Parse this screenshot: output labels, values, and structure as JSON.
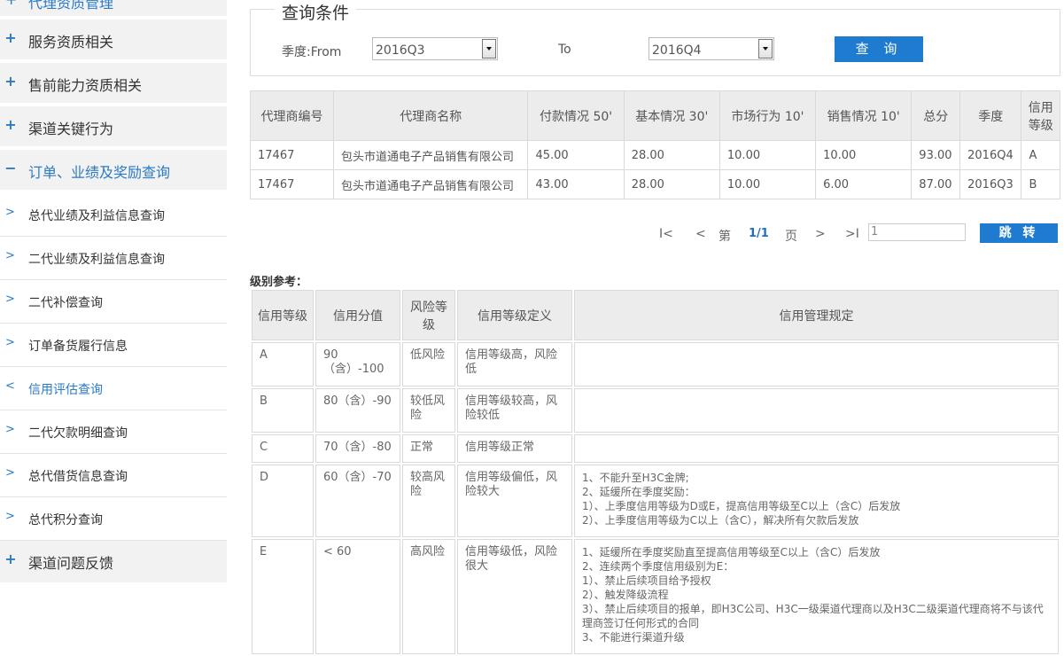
{
  "sidebar": {
    "cut_label": "代理资质管理",
    "cut_icon": "+",
    "main_items": [
      {
        "icon": "+",
        "label": "服务资质相关"
      },
      {
        "icon": "+",
        "label": "售前能力资质相关"
      },
      {
        "icon": "+",
        "label": "渠道关键行为"
      },
      {
        "icon": "−",
        "label": "订单、业绩及奖励查询"
      }
    ],
    "sub_items": [
      {
        "icon": ">",
        "label": "总代业绩及利益信息查询"
      },
      {
        "icon": ">",
        "label": "二代业绩及利益信息查询"
      },
      {
        "icon": ">",
        "label": "二代补偿查询"
      },
      {
        "icon": ">",
        "label": "订单备货履行信息"
      },
      {
        "icon": "<",
        "label": "信用评估查询"
      },
      {
        "icon": ">",
        "label": "二代欠款明细查询"
      },
      {
        "icon": ">",
        "label": "总代借货信息查询"
      },
      {
        "icon": ">",
        "label": "总代积分查询"
      }
    ],
    "bottom_item": {
      "icon": "+",
      "label": "渠道问题反馈"
    }
  },
  "query": {
    "title": "查询条件",
    "from_label": "季度:From",
    "from_value": "2016Q3",
    "to_label": "To",
    "to_value": "2016Q4",
    "search_label": "查 询"
  },
  "results": {
    "headers": [
      "代理商编号",
      "代理商名称",
      "付款情况 50'",
      "基本情况 30'",
      "市场行为 10'",
      "销售情况 10'",
      "总分",
      "季度",
      "信用等级"
    ],
    "rows": [
      [
        "17467",
        "包头市道通电子产品销售有限公司",
        "45.00",
        "28.00",
        "10.00",
        "10.00",
        "93.00",
        "2016Q4",
        "A"
      ],
      [
        "17467",
        "包头市道通电子产品销售有限公司",
        "43.00",
        "28.00",
        "10.00",
        "6.00",
        "87.00",
        "2016Q3",
        "B"
      ]
    ]
  },
  "pager": {
    "first": "I<",
    "prev": "<",
    "page_prefix": "第",
    "page_value": "1/1",
    "page_suffix": "页",
    "next": ">",
    "last": ">I",
    "input_value": "1",
    "jump_label": "跳 转"
  },
  "reference": {
    "label": "级别参考：",
    "headers": [
      "信用等级",
      "信用分值",
      "风险等级",
      "信用等级定义",
      "信用管理规定"
    ],
    "rows": [
      {
        "grade": "A",
        "score": "90（含）-100",
        "risk": "低风险",
        "definition": "信用等级高，风险低",
        "rules": []
      },
      {
        "grade": "B",
        "score": "80（含）-90",
        "risk": "较低风险",
        "definition": "信用等级较高，风险较低",
        "rules": []
      },
      {
        "grade": "C",
        "score": "70（含）-80",
        "risk": "正常",
        "definition": "信用等级正常",
        "rules": []
      },
      {
        "grade": "D",
        "score": "60（含）-70",
        "risk": "较高风险",
        "definition": "信用等级偏低，风险较大",
        "rules": [
          "1、不能升至H3C金牌;",
          "2、延缓所在季度奖励：",
          "1）、上季度信用等级为D或E，提高信用等级至C以上（含C）后发放",
          "2）、上季度信用等级为C以上（含C），解决所有欠款后发放"
        ]
      },
      {
        "grade": "E",
        "score": "< 60",
        "risk": "高风险",
        "definition": "信用等级低，风险很大",
        "rules": [
          "1、延缓所在季度奖励直至提高信用等级至C以上（含C）后发放",
          "2、连续两个季度信用级别为E：",
          "1）、禁止后续项目给予授权",
          "2）、触发降级流程",
          "3）、禁止后续项目的报单，即H3C公司、H3C一级渠道代理商以及H3C二级渠道代理商将不与该代理商签订任何形式的合同",
          "3、不能进行渠道升级"
        ]
      }
    ]
  }
}
